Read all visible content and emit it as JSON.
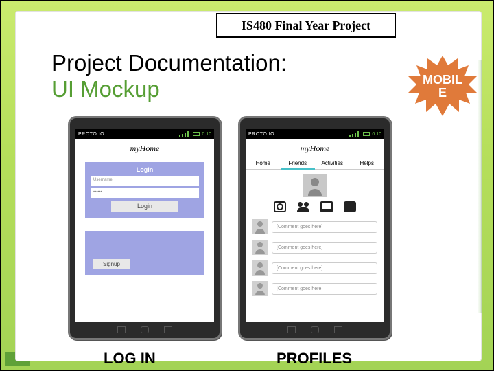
{
  "slide": {
    "header": "IS480 Final Year Project",
    "headline_line1": "Project Documentation:",
    "headline_line2": "UI Mockup",
    "badge_line1": "MOBIL",
    "badge_line2": "E"
  },
  "status": {
    "brand": "PROTO.IO",
    "time": "0:10"
  },
  "app": {
    "title": "myHome"
  },
  "login": {
    "header": "Login",
    "username_placeholder": "Username",
    "password_placeholder": "••••••",
    "login_btn": "Login",
    "signup_btn": "Signup"
  },
  "profile": {
    "tabs": [
      "Home",
      "Friends",
      "Activities",
      "Helps"
    ],
    "comments": [
      "[Comment goes here]",
      "[Comment goes here]",
      "[Comment goes here]",
      "[Comment goes here]"
    ]
  },
  "captions": {
    "left": "LOG IN",
    "right": "PROFILES"
  }
}
